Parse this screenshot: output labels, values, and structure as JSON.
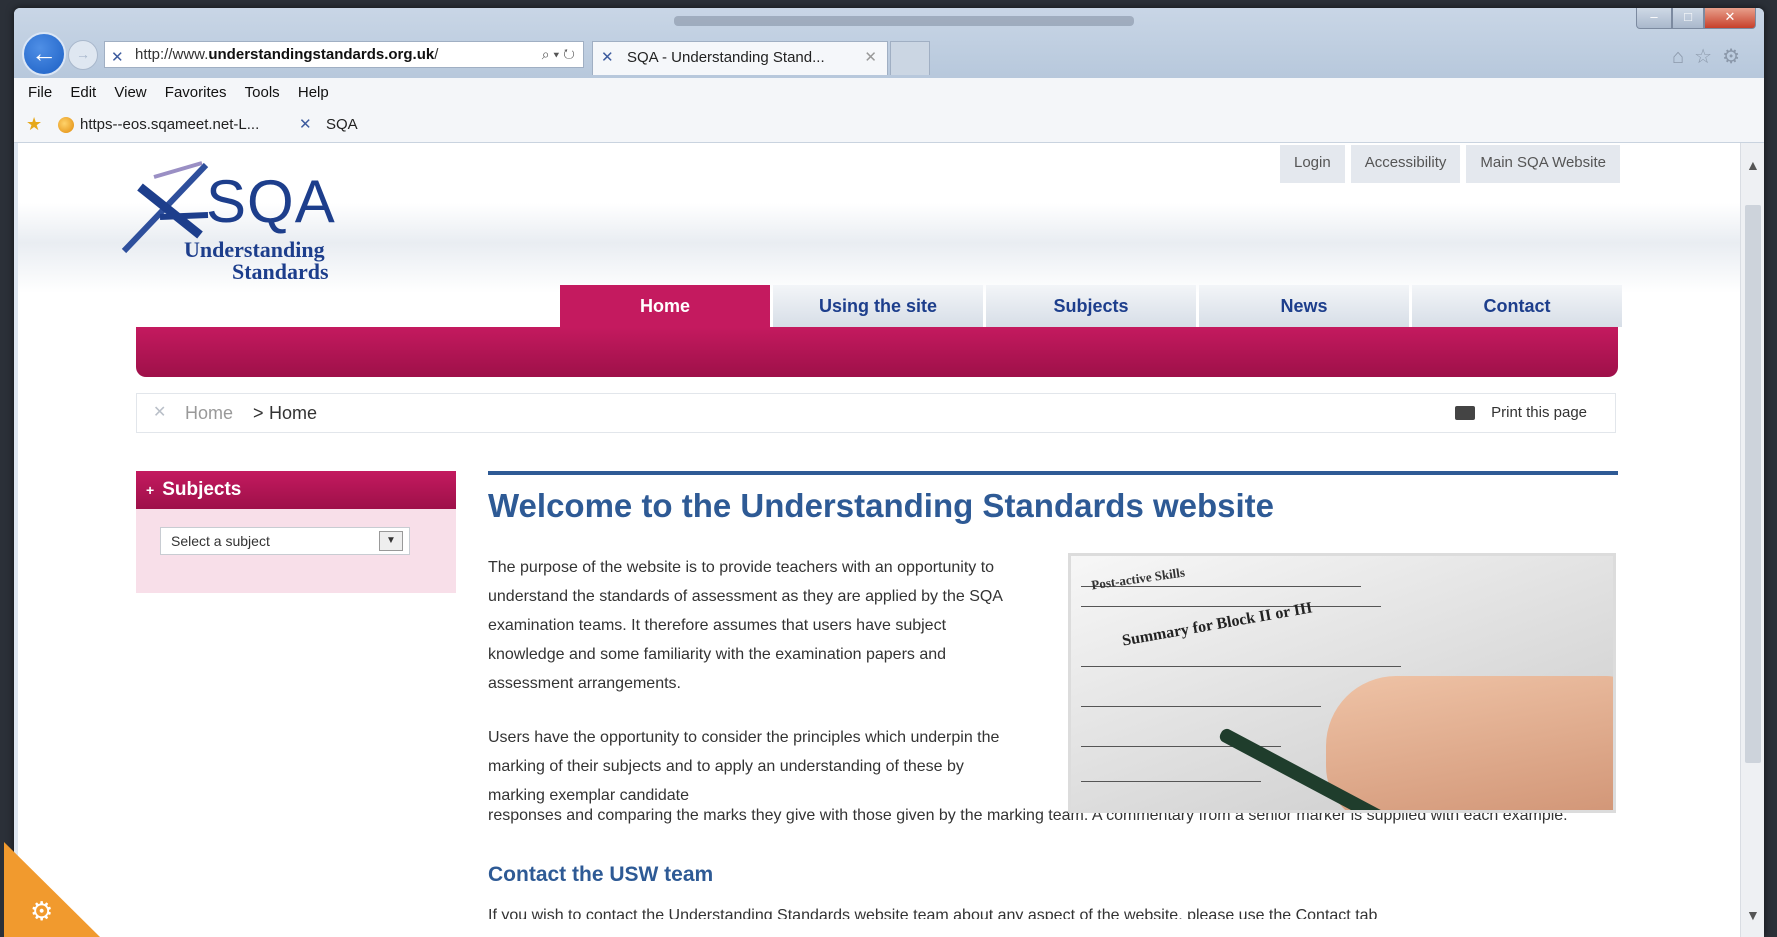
{
  "browser": {
    "address": {
      "prefix": "http://www.",
      "domain": "understandingstandards.org.uk",
      "suffix": "/"
    },
    "tab_title": "SQA - Understanding Stand...",
    "menu": [
      "File",
      "Edit",
      "View",
      "Favorites",
      "Tools",
      "Help"
    ],
    "favorites": [
      "https--eos.sqameet.net-L...",
      "SQA"
    ]
  },
  "header": {
    "logo_mark": "SQA",
    "logo_sub1": "Understanding",
    "logo_sub2": "Standards",
    "toplinks": [
      "Login",
      "Accessibility",
      "Main SQA Website"
    ]
  },
  "nav": [
    "Home",
    "Using the site",
    "Subjects",
    "News",
    "Contact"
  ],
  "breadcrumb": {
    "home": "Home",
    "sep": ">",
    "current": "Home",
    "print": "Print this page"
  },
  "sidebar": {
    "title": "Subjects",
    "select_value": "Select a subject"
  },
  "main": {
    "heading": "Welcome to the Understanding Standards website",
    "p1": "The purpose of the website is to provide teachers with an opportunity to understand the standards of assessment as they are applied by the SQA examination teams. It therefore assumes that users have subject knowledge and some familiarity with the examination papers and assessment arrangements.",
    "p2": "Users have the opportunity to consider the principles which underpin the marking of their subjects and to apply an understanding of these by marking exemplar candidate",
    "p3": "responses and comparing the marks they give with those given by the marking team. A commentary from a senior marker is supplied with each example.",
    "h2": "Contact the USW team",
    "p4": "If you wish to contact the Understanding Standards website team about any aspect of the website, please use the Contact tab",
    "photo_text1": "Summary for Block II or III",
    "photo_text2": "Post-active Skills"
  },
  "colors": {
    "brand_pink": "#c41a5f",
    "brand_blue": "#1d3e8c",
    "heading_blue": "#2e5a95"
  }
}
